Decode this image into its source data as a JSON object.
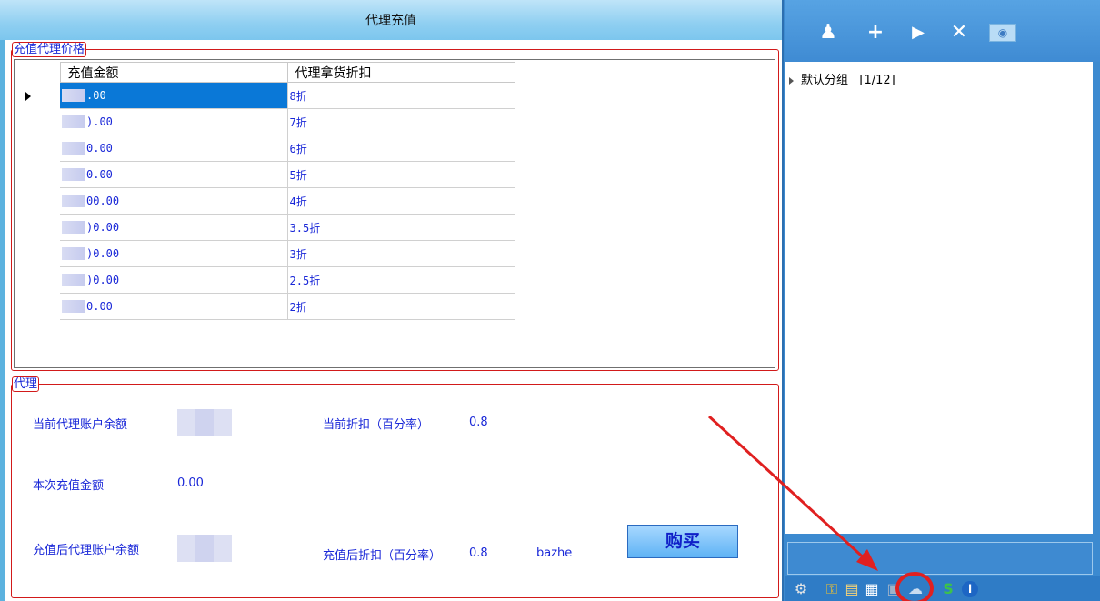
{
  "window": {
    "title": "代理充值"
  },
  "price_group": {
    "legend": "充值代理价格",
    "headers": [
      "充值金额",
      "代理拿货折扣"
    ],
    "rows": [
      {
        "amount": ".00",
        "discount_num": "8",
        "discount_unit": "折"
      },
      {
        "amount": ").00",
        "discount_num": "7",
        "discount_unit": "折"
      },
      {
        "amount": "0.00",
        "discount_num": "6",
        "discount_unit": "折"
      },
      {
        "amount": "0.00",
        "discount_num": "5",
        "discount_unit": "折"
      },
      {
        "amount": "00.00",
        "discount_num": "4",
        "discount_unit": "折"
      },
      {
        "amount": ")0.00",
        "discount_num": "3.5",
        "discount_unit": "折"
      },
      {
        "amount": ")0.00",
        "discount_num": "3",
        "discount_unit": "折"
      },
      {
        "amount": ")0.00",
        "discount_num": "2.5",
        "discount_unit": "折"
      },
      {
        "amount": "0.00",
        "discount_num": "2",
        "discount_unit": "折"
      }
    ]
  },
  "agent_group": {
    "legend": "代理",
    "current_balance_label": "当前代理账户余额",
    "current_discount_label": "当前折扣（百分率）",
    "current_discount_value": "0.8",
    "recharge_amount_label": "本次充值金额",
    "recharge_amount_value": "0.00",
    "after_balance_label": "充值后代理账户余额",
    "after_discount_label": "充值后折扣（百分率）",
    "after_discount_value": "0.8",
    "user_name": "bazhe",
    "buy_label": "购买"
  },
  "right_panel": {
    "tree_group": "默认分组",
    "tree_count": "[1/12]",
    "toolbar_icons": [
      "user-icon",
      "add-icon",
      "play-icon",
      "close-icon",
      "stop-icon"
    ],
    "bottom_icons": [
      "gear-icon",
      "key-icon",
      "lock-icon",
      "cart-icon",
      "card-icon",
      "cloud-icon",
      "refresh-icon",
      "info-icon"
    ]
  },
  "colors": {
    "accent_red": "#e02020",
    "label_blue": "#1a28d8",
    "select_blue": "#0a78d7"
  }
}
